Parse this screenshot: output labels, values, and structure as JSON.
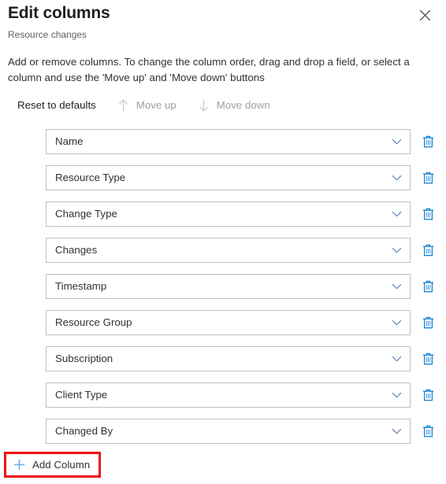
{
  "panel": {
    "title": "Edit columns",
    "subtitle": "Resource changes",
    "description": "Add or remove columns. To change the column order, drag and drop a field, or select a column and use the 'Move up' and 'Move down' buttons",
    "close_icon": "close-icon"
  },
  "command_bar": {
    "items": [
      {
        "label": "Reset to defaults",
        "icon": "",
        "enabled": true
      },
      {
        "label": "Move up",
        "icon": "arrow-up-icon",
        "enabled": false
      },
      {
        "label": "Move down",
        "icon": "arrow-down-icon",
        "enabled": false
      }
    ]
  },
  "columns": [
    {
      "value": "Name",
      "chevron_icon": "chevron-down-icon",
      "delete_icon": "trash-icon"
    },
    {
      "value": "Resource Type",
      "chevron_icon": "chevron-down-icon",
      "delete_icon": "trash-icon"
    },
    {
      "value": "Change Type",
      "chevron_icon": "chevron-down-icon",
      "delete_icon": "trash-icon"
    },
    {
      "value": "Changes",
      "chevron_icon": "chevron-down-icon",
      "delete_icon": "trash-icon"
    },
    {
      "value": "Timestamp",
      "chevron_icon": "chevron-down-icon",
      "delete_icon": "trash-icon"
    },
    {
      "value": "Resource Group",
      "chevron_icon": "chevron-down-icon",
      "delete_icon": "trash-icon"
    },
    {
      "value": "Subscription",
      "chevron_icon": "chevron-down-icon",
      "delete_icon": "trash-icon"
    },
    {
      "value": "Client Type",
      "chevron_icon": "chevron-down-icon",
      "delete_icon": "trash-icon"
    },
    {
      "value": "Changed By",
      "chevron_icon": "chevron-down-icon",
      "delete_icon": "trash-icon"
    }
  ],
  "add_column": {
    "label": "Add Column",
    "icon": "plus-icon",
    "highlight_color": "#ee1111"
  },
  "colors": {
    "accent_blue": "#0078d4",
    "icon_blue": "#4a9bea",
    "text_primary": "#323130",
    "text_secondary": "#605e5c",
    "text_disabled": "#a19f9d",
    "border": "#bfbfbf",
    "background": "#ffffff"
  }
}
